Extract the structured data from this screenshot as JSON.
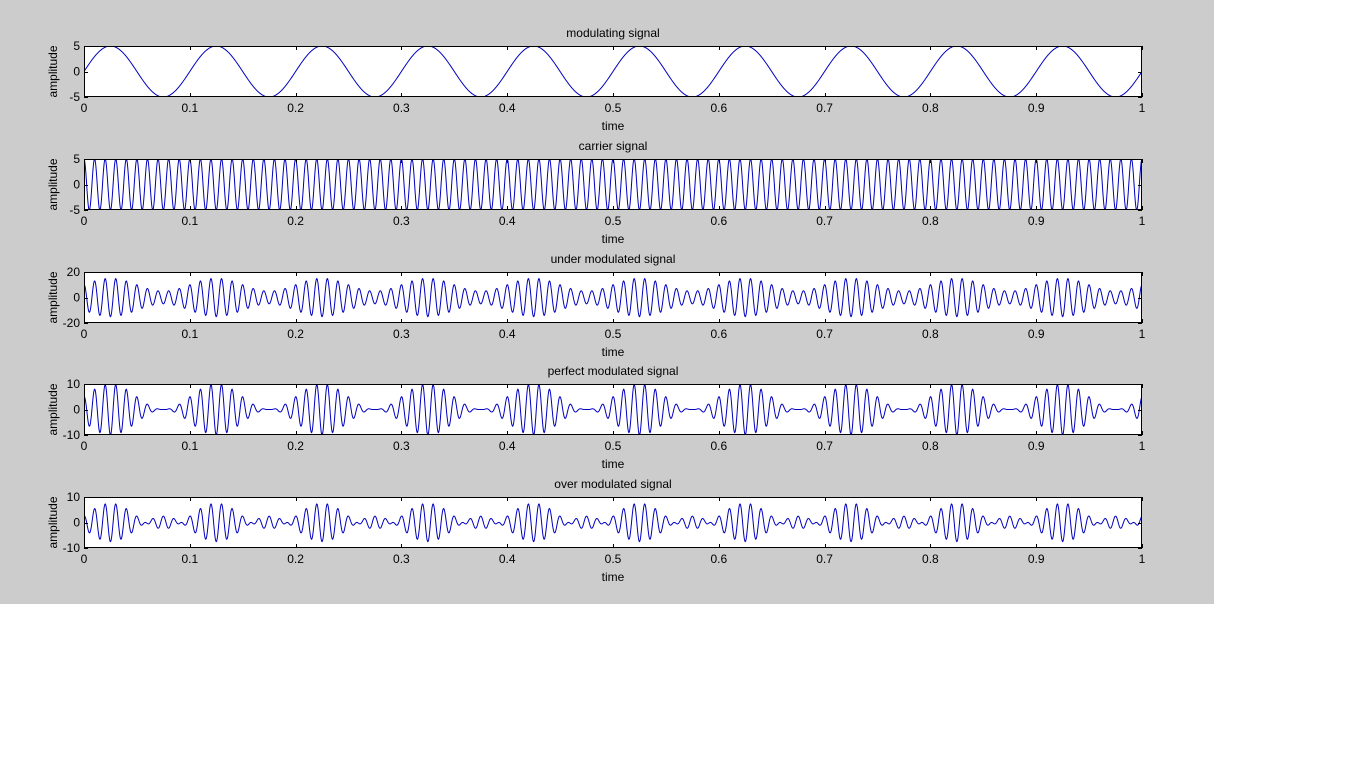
{
  "figure": {
    "background": "#cccccc",
    "axes_background": "#ffffff",
    "line_color": "#0000bf"
  },
  "chart_data": [
    {
      "type": "line",
      "title": "modulating signal",
      "xlabel": "time",
      "ylabel": "amplitude",
      "xlim": [
        0,
        1
      ],
      "ylim": [
        -5,
        5
      ],
      "xticks": [
        "0",
        "0.1",
        "0.2",
        "0.3",
        "0.4",
        "0.5",
        "0.6",
        "0.7",
        "0.8",
        "0.9",
        "1"
      ],
      "yticks": [
        "5",
        "0",
        "-5"
      ],
      "grid": false,
      "series": [
        {
          "color": "#0000bf",
          "function": "5*sin(2*pi*10*t)",
          "t_range": [
            0,
            1
          ]
        }
      ]
    },
    {
      "type": "line",
      "title": "carrier signal",
      "xlabel": "time",
      "ylabel": "amplitude",
      "xlim": [
        0,
        1
      ],
      "ylim": [
        -5,
        5
      ],
      "xticks": [
        "0",
        "0.1",
        "0.2",
        "0.3",
        "0.4",
        "0.5",
        "0.6",
        "0.7",
        "0.8",
        "0.9",
        "1"
      ],
      "yticks": [
        "5",
        "0",
        "-5"
      ],
      "grid": false,
      "series": [
        {
          "color": "#0000bf",
          "function": "5*cos(2*pi*100*t)",
          "t_range": [
            0,
            1
          ]
        }
      ]
    },
    {
      "type": "line",
      "title": "under modulated signal",
      "xlabel": "time",
      "ylabel": "amplitude",
      "xlim": [
        0,
        1
      ],
      "ylim": [
        -20,
        20
      ],
      "xticks": [
        "0",
        "0.1",
        "0.2",
        "0.3",
        "0.4",
        "0.5",
        "0.6",
        "0.7",
        "0.8",
        "0.9",
        "1"
      ],
      "yticks": [
        "20",
        "0",
        "-20"
      ],
      "grid": false,
      "series": [
        {
          "color": "#0000bf",
          "function": "(10+5*sin(2*pi*10*t))*cos(2*pi*100*t)",
          "t_range": [
            0,
            1
          ]
        }
      ]
    },
    {
      "type": "line",
      "title": "perfect modulated signal",
      "xlabel": "time",
      "ylabel": "amplitude",
      "xlim": [
        0,
        1
      ],
      "ylim": [
        -10,
        10
      ],
      "xticks": [
        "0",
        "0.1",
        "0.2",
        "0.3",
        "0.4",
        "0.5",
        "0.6",
        "0.7",
        "0.8",
        "0.9",
        "1"
      ],
      "yticks": [
        "10",
        "0",
        "-10"
      ],
      "grid": false,
      "series": [
        {
          "color": "#0000bf",
          "function": "(5+5*sin(2*pi*10*t))*cos(2*pi*100*t)",
          "t_range": [
            0,
            1
          ]
        }
      ]
    },
    {
      "type": "line",
      "title": "over modulated signal",
      "xlabel": "time",
      "ylabel": "amplitude",
      "xlim": [
        0,
        1
      ],
      "ylim": [
        -10,
        10
      ],
      "xticks": [
        "0",
        "0.1",
        "0.2",
        "0.3",
        "0.4",
        "0.5",
        "0.6",
        "0.7",
        "0.8",
        "0.9",
        "1"
      ],
      "yticks": [
        "10",
        "0",
        "-10"
      ],
      "grid": false,
      "series": [
        {
          "color": "#0000bf",
          "function": "(2.5+5*sin(2*pi*10*t))*cos(2*pi*100*t)",
          "t_range": [
            0,
            1
          ]
        }
      ]
    }
  ]
}
